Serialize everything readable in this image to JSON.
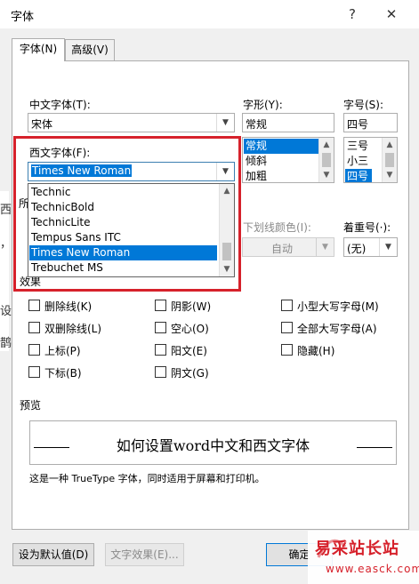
{
  "window": {
    "title": "字体",
    "help_icon": "?",
    "close_icon": "✕"
  },
  "tabs": [
    {
      "label": "字体(N)",
      "active": true
    },
    {
      "label": "高级(V)",
      "active": false
    }
  ],
  "background_text": [
    "西",
    "，",
    "设",
    "鹊"
  ],
  "chinese_font": {
    "label": "中文字体(T):",
    "value": "宋体"
  },
  "font_style": {
    "label": "字形(Y):",
    "value": "常规",
    "options": [
      "常规",
      "倾斜",
      "加粗"
    ],
    "selected": "常规"
  },
  "font_size": {
    "label": "字号(S):",
    "value": "四号",
    "options": [
      "三号",
      "小三",
      "四号"
    ],
    "selected": "四号"
  },
  "western_font": {
    "label": "西文字体(F):",
    "value": "Times New Roman",
    "dropdown_options": [
      "Technic",
      "TechnicBold",
      "TechnicLite",
      "Tempus Sans ITC",
      "Times New Roman",
      "Trebuchet MS"
    ],
    "selected": "Times New Roman"
  },
  "all_text_label_fragment": "所",
  "underline_color": {
    "label": "下划线颜色(I):",
    "value": "自动"
  },
  "emphasis": {
    "label": "着重号(·):",
    "value": "(无)"
  },
  "effects": {
    "label": "效果",
    "items": [
      {
        "label": "删除线(K)",
        "checked": false
      },
      {
        "label": "阴影(W)",
        "checked": false
      },
      {
        "label": "小型大写字母(M)",
        "checked": false
      },
      {
        "label": "双删除线(L)",
        "checked": false
      },
      {
        "label": "空心(O)",
        "checked": false
      },
      {
        "label": "全部大写字母(A)",
        "checked": false
      },
      {
        "label": "上标(P)",
        "checked": false
      },
      {
        "label": "阳文(E)",
        "checked": false
      },
      {
        "label": "隐藏(H)",
        "checked": false
      },
      {
        "label": "下标(B)",
        "checked": false
      },
      {
        "label": "阴文(G)",
        "checked": false
      }
    ]
  },
  "preview": {
    "label": "预览",
    "sample_text": "如何设置word中文和西文字体",
    "description": "这是一种 TrueType 字体，同时适用于屏幕和打印机。"
  },
  "buttons": {
    "set_default": "设为默认值(D)",
    "text_effects": "文字效果(E)...",
    "ok": "确定"
  },
  "watermark": {
    "name": "易采站长站",
    "url": "www.easck.com"
  },
  "colors": {
    "accent_blue": "#0078d7",
    "highlight_red": "#d6212b",
    "dialog_bg": "#f0f0f0"
  }
}
